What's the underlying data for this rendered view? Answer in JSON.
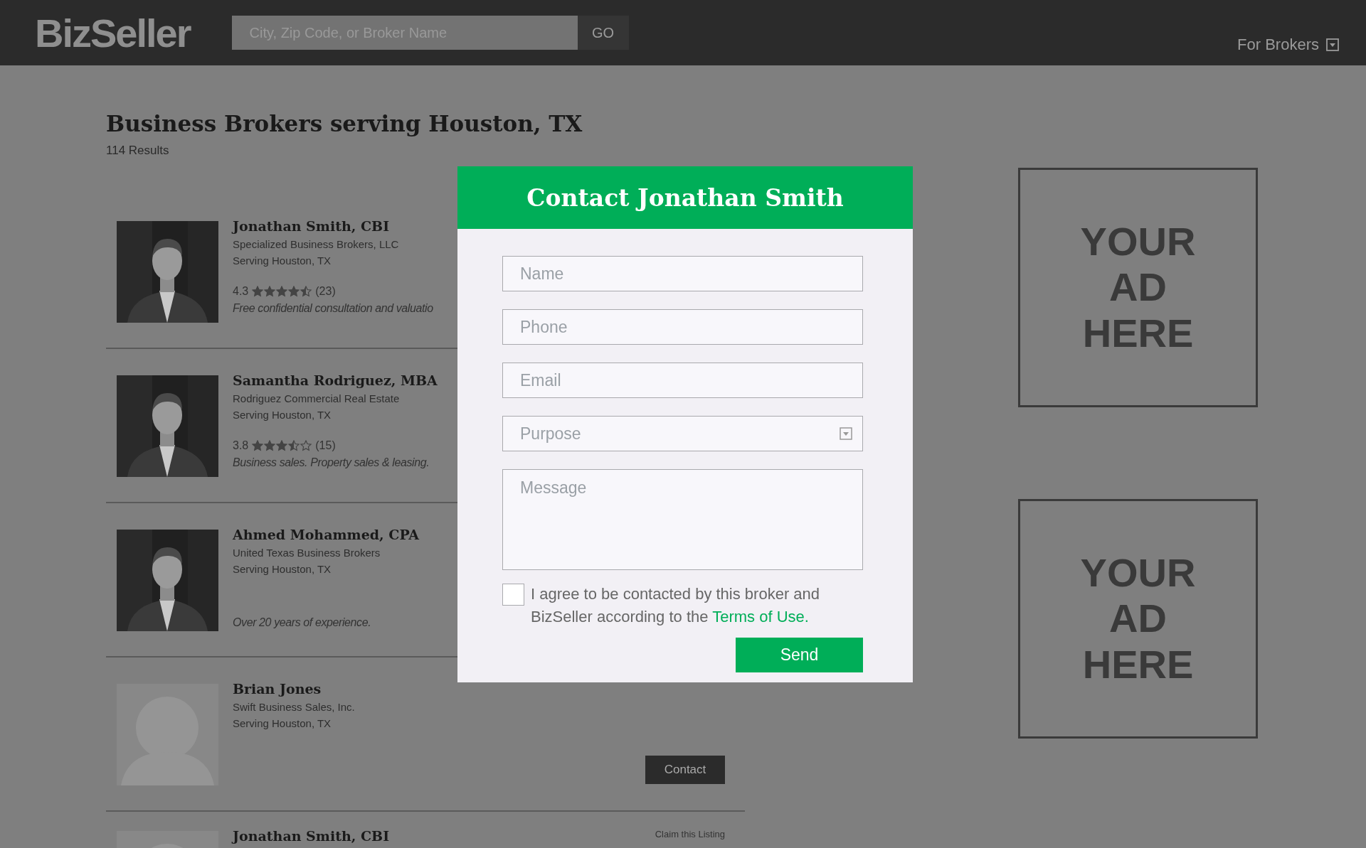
{
  "header": {
    "logo": "BizSeller",
    "search": {
      "placeholder": "City, Zip Code, or Broker Name",
      "button": "GO"
    },
    "menu": "For Brokers"
  },
  "page": {
    "title": "Business Brokers serving Houston, TX",
    "results": "114 Results"
  },
  "brokers": [
    {
      "name": "Jonathan Smith, CBI",
      "company": "Specialized Business Brokers, LLC",
      "area": "Serving Houston, TX",
      "rating": "4.3",
      "stars": 4.5,
      "reviews": "(23)",
      "blurb": "Free confidential consultation and valuatio"
    },
    {
      "name": "Samantha Rodriguez, MBA",
      "company": "Rodriguez Commercial Real Estate",
      "area": "Serving Houston, TX",
      "rating": "3.8",
      "stars": 3.5,
      "reviews": "(15)",
      "blurb": "Business sales. Property sales & leasing."
    },
    {
      "name": "Ahmed Mohammed, CPA",
      "company": "United Texas Business Brokers",
      "area": "Serving Houston, TX",
      "blurb": "Over 20 years of experience."
    },
    {
      "name": "Brian Jones",
      "company": "Swift Business Sales, Inc.",
      "area": "Serving Houston, TX",
      "contact": "Contact",
      "photo": {
        "kind": "placeholder"
      }
    },
    {
      "name": "Jonathan Smith, CBI",
      "claim": "Claim this Listing",
      "photo": {
        "kind": "placeholder"
      }
    }
  ],
  "ads": [
    "YOUR AD HERE",
    "YOUR AD HERE"
  ],
  "modal": {
    "title": "Contact Jonathan Smith",
    "fields": [
      {
        "kind": "text",
        "placeholder": "Name"
      },
      {
        "kind": "text",
        "placeholder": "Phone"
      },
      {
        "kind": "text",
        "placeholder": "Email"
      },
      {
        "kind": "select",
        "placeholder": "Purpose"
      },
      {
        "kind": "textarea",
        "placeholder": "Message"
      }
    ],
    "agree": {
      "checked": false,
      "text": "I agree to be contacted by this broker and BizSeller according to the",
      "link": "Terms of Use."
    },
    "send": "Send"
  }
}
